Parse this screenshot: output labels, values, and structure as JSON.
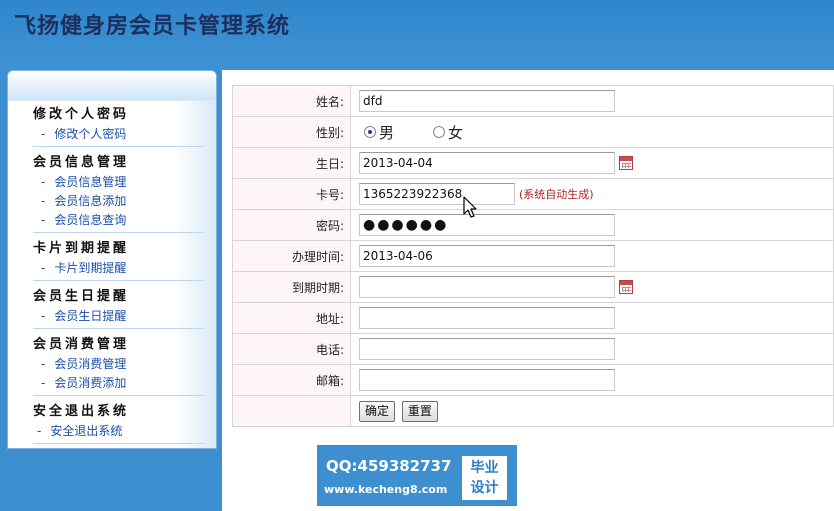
{
  "app": {
    "title": "飞扬健身房会员卡管理系统"
  },
  "sidebar": {
    "groups": [
      {
        "title": "修改个人密码",
        "items": [
          "修改个人密码"
        ]
      },
      {
        "title": "会员信息管理",
        "items": [
          "会员信息管理",
          "会员信息添加",
          "会员信息查询"
        ]
      },
      {
        "title": "卡片到期提醒",
        "items": [
          "卡片到期提醒"
        ]
      },
      {
        "title": "会员生日提醒",
        "items": [
          "会员生日提醒"
        ]
      },
      {
        "title": "会员消费管理",
        "items": [
          "会员消费管理",
          "会员消费添加"
        ]
      },
      {
        "title": "安全退出系统",
        "items": [
          "安全退出系统"
        ]
      }
    ],
    "dash": "-"
  },
  "form": {
    "name": {
      "label": "姓名:",
      "value": "dfd"
    },
    "gender": {
      "label": "性别:",
      "options": [
        "男",
        "女"
      ],
      "selected": "男"
    },
    "birthday": {
      "label": "生日:",
      "value": "2013-04-04"
    },
    "card": {
      "label": "卡号:",
      "value": "1365223922368",
      "hint": "(系统自动生成)"
    },
    "password": {
      "label": "密码:",
      "value": "●●●●●●"
    },
    "issue_date": {
      "label": "办理时间:",
      "value": "2013-04-06"
    },
    "expire_date": {
      "label": "到期时期:",
      "value": ""
    },
    "address": {
      "label": "地址:",
      "value": ""
    },
    "phone": {
      "label": "电话:",
      "value": ""
    },
    "email": {
      "label": "邮箱:",
      "value": ""
    },
    "submit_label": "确定",
    "reset_label": "重置"
  },
  "watermark": {
    "qq": "QQ:459382737",
    "url": "www.kecheng8.com",
    "badge_line1": "毕业",
    "badge_line2": "设计"
  },
  "colors": {
    "header_bg": "#2f86cb",
    "title_text": "#1d2f5e",
    "menu_link": "#1b4fa8",
    "hint_text": "#b22222"
  }
}
